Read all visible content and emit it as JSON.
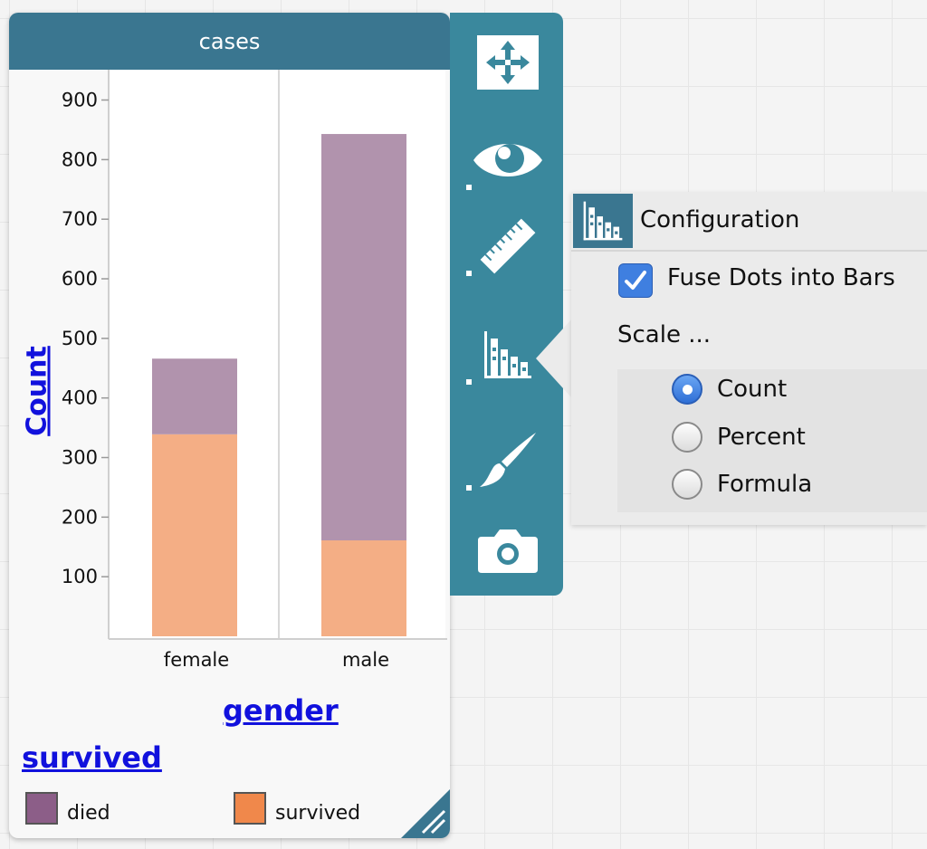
{
  "tile": {
    "title": "cases"
  },
  "chart_data": {
    "type": "bar",
    "stacked": true,
    "categories": [
      "female",
      "male"
    ],
    "series": [
      {
        "name": "survived",
        "color": "#f4ae85",
        "values": [
          339,
          161
        ]
      },
      {
        "name": "died",
        "color": "#b193ad",
        "values": [
          127,
          682
        ]
      }
    ],
    "xlabel": "gender",
    "ylabel": "Count",
    "yticks": [
      100,
      200,
      300,
      400,
      500,
      600,
      700,
      800,
      900
    ],
    "ylim": [
      0,
      900
    ]
  },
  "legend": {
    "attribute": "survived",
    "items": [
      {
        "label": "died",
        "color": "#8c5e88"
      },
      {
        "label": "survived",
        "color": "#f0884b"
      }
    ]
  },
  "inspector": {
    "tools": [
      "move-icon",
      "eye-icon",
      "ruler-icon",
      "bar-chart-icon",
      "brush-icon",
      "camera-icon"
    ]
  },
  "config": {
    "title": "Configuration",
    "fuse_label": "Fuse Dots into Bars",
    "fuse_checked": true,
    "scale_label": "Scale ...",
    "options": [
      "Count",
      "Percent",
      "Formula"
    ],
    "selected": "Count"
  }
}
